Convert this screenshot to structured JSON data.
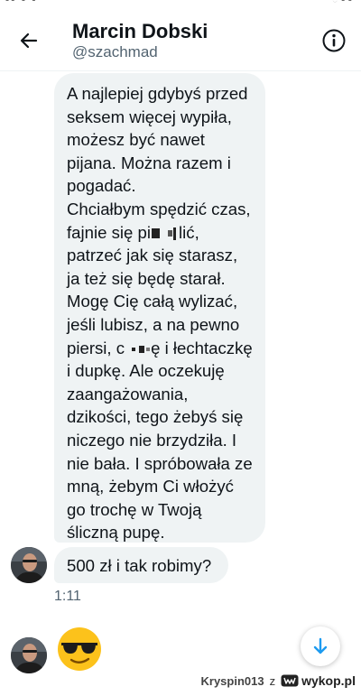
{
  "header": {
    "name": "Marcin Dobski",
    "handle": "@szachmad"
  },
  "conversation": {
    "message_long": {
      "lines": [
        {
          "text": "A najlepiej gdybyś przed"
        },
        {
          "text": "seksem więcej wypiła,"
        },
        {
          "text": "możesz być nawet"
        },
        {
          "text": "pijana. Można razem i"
        },
        {
          "text": "pogadać."
        },
        {
          "text": "Chciałbym spędzić czas,"
        },
        {
          "pre": "fajnie się pi",
          "post": "lić,"
        },
        {
          "text": "patrzeć jak się starasz,"
        },
        {
          "text": "ja też się będę starał."
        },
        {
          "text": "Mogę Cię całą wylizać,"
        },
        {
          "text": "jeśli lubisz, a na pewno"
        },
        {
          "pre": "piersi, c",
          "post": "ę i łechtaczkę"
        },
        {
          "text": "i dupkę. Ale oczekuję"
        },
        {
          "text": "zaangażowania,"
        },
        {
          "text": "dzikości, tego żebyś się"
        },
        {
          "text": "niczego nie brzydziła. I"
        },
        {
          "text": "nie bała. I spróbowała ze"
        },
        {
          "text": "mną, żebym Ci włożyć"
        },
        {
          "text": "go trochę w Twoją"
        },
        {
          "text": "śliczną pupę."
        }
      ]
    },
    "message_short": "500 zł i tak robimy?",
    "timestamp": "1:11"
  },
  "watermark": {
    "user": "Kryspin013",
    "separator": "z",
    "site": "wykop.pl"
  },
  "icons": {
    "back": "arrow-left-icon",
    "info": "info-icon",
    "scroll": "arrow-down-icon",
    "emoji": "sunglasses-emoji"
  },
  "colors": {
    "accent": "#1d9bf0",
    "bubble": "#eff3f4",
    "secondary_text": "#536471"
  }
}
